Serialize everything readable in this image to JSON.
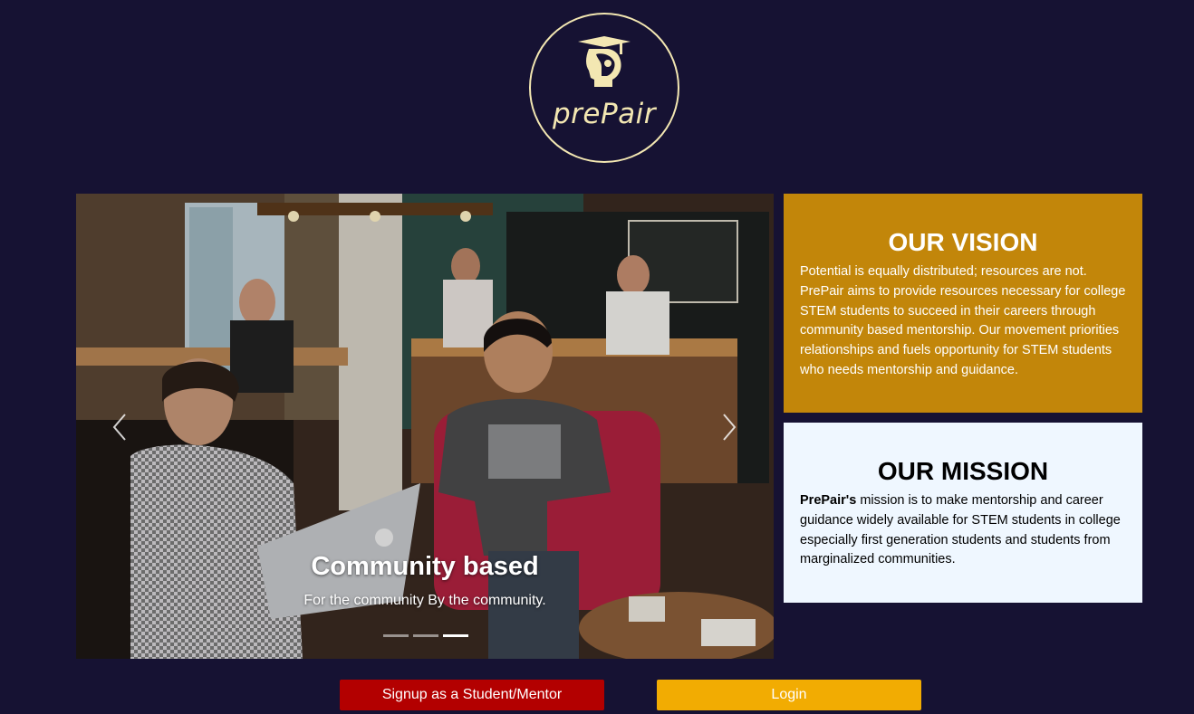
{
  "brand": {
    "name": "prePair"
  },
  "carousel": {
    "slide_title": "Community based",
    "slide_caption": "For the community By the community.",
    "slide_count": 3,
    "active_slide": 3
  },
  "vision": {
    "title": "OUR VISION",
    "body": "Potential is equally distributed; resources are not. PrePair aims to provide resources necessary for college STEM students to succeed in their careers through community based mentorship. Our movement priorities relationships and fuels opportunity for STEM students who needs mentorship and guidance."
  },
  "mission": {
    "title": "OUR MISSION",
    "body_bold": "PrePair's",
    "body": " mission is to make mentorship and career guidance widely available for STEM students in college especially first generation students and students from marginalized communities."
  },
  "actions": {
    "signup_label": "Signup as a Student/Mentor",
    "login_label": "Login"
  },
  "colors": {
    "background": "#161233",
    "vision_bg": "#c2860a",
    "mission_bg": "#eff7ff",
    "signup_bg": "#b30000",
    "login_bg": "#f2ac02",
    "logo": "#f3e7b2"
  }
}
